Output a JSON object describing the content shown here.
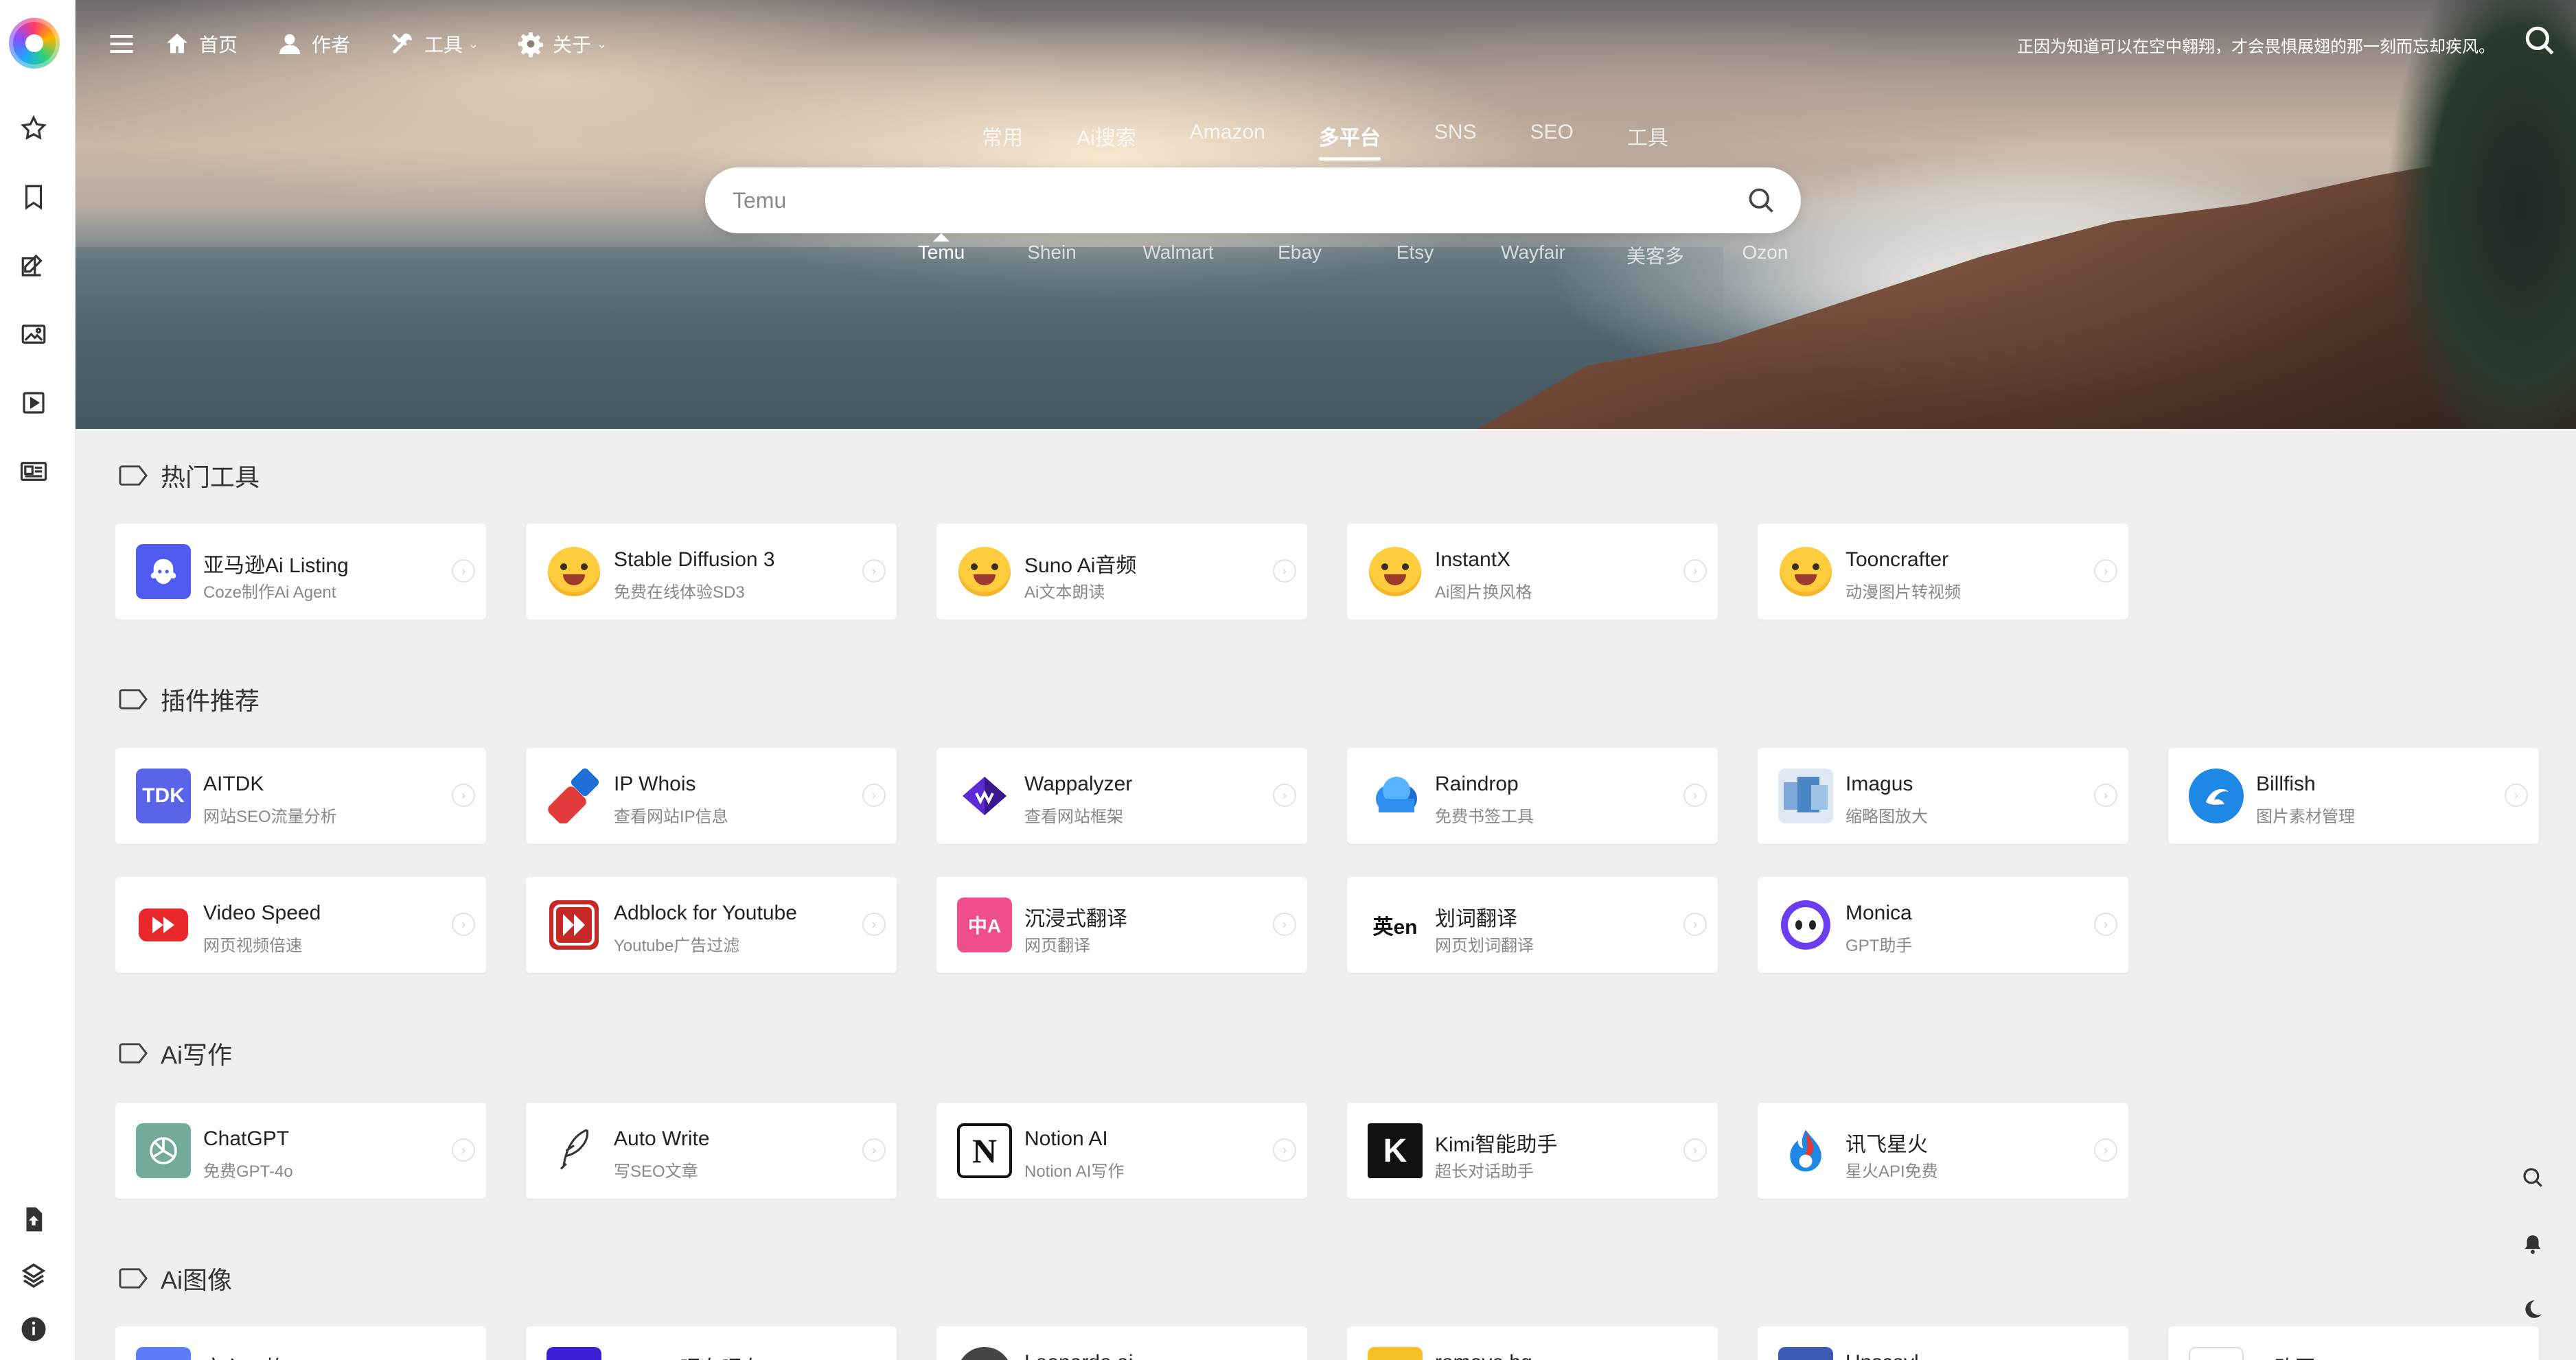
{
  "nav": {
    "items": [
      {
        "label": "首页",
        "icon": "home-icon"
      },
      {
        "label": "作者",
        "icon": "user-icon"
      },
      {
        "label": "工具",
        "icon": "tools-icon",
        "has_caret": true
      },
      {
        "label": "关于",
        "icon": "gear-icon",
        "has_caret": true
      }
    ],
    "motto": "正因为知道可以在空中翱翔，才会畏惧展翅的那一刻而忘却疾风。"
  },
  "search": {
    "category_tabs": [
      "常用",
      "Ai搜索",
      "Amazon",
      "多平台",
      "SNS",
      "SEO",
      "工具"
    ],
    "active_category": "多平台",
    "placeholder": "Temu",
    "engines": [
      "Temu",
      "Shein",
      "Walmart",
      "Ebay",
      "Etsy",
      "Wayfair",
      "美客多",
      "Ozon"
    ],
    "active_engine": "Temu"
  },
  "sections": [
    {
      "title": "热门工具",
      "cards": [
        {
          "name": "亚马逊Ai Listing",
          "desc": "Coze制作Ai Agent",
          "icon": "coze-icon",
          "color": "#4f5bf0"
        },
        {
          "name": "Stable Diffusion 3",
          "desc": "免费在线体验SD3",
          "icon": "hugging-face-icon",
          "color": "#ffcc3d"
        },
        {
          "name": "Suno Ai音频",
          "desc": "Ai文本朗读",
          "icon": "hugging-face-icon",
          "color": "#ffcc3d"
        },
        {
          "name": "InstantX",
          "desc": "Ai图片换风格",
          "icon": "hugging-face-icon",
          "color": "#ffcc3d"
        },
        {
          "name": "Tooncrafter",
          "desc": "动漫图片转视频",
          "icon": "hugging-face-icon",
          "color": "#ffcc3d"
        }
      ]
    },
    {
      "title": "插件推荐",
      "cards": [
        {
          "name": "AITDK",
          "desc": "网站SEO流量分析",
          "icon": "tdk-icon",
          "color": "#5b63e8",
          "glyph": "TDK"
        },
        {
          "name": "IP Whois",
          "desc": "查看网站IP信息",
          "icon": "ip-whois-icon",
          "color": "#e23b3b"
        },
        {
          "name": "Wappalyzer",
          "desc": "查看网站框架",
          "icon": "wappalyzer-icon",
          "color": "#5b2bd6"
        },
        {
          "name": "Raindrop",
          "desc": "免费书签工具",
          "icon": "raindrop-icon",
          "color": "#2f8ff0"
        },
        {
          "name": "Imagus",
          "desc": "缩略图放大",
          "icon": "imagus-icon",
          "color": "#6aa0d8"
        },
        {
          "name": "Billfish",
          "desc": "图片素材管理",
          "icon": "billfish-icon",
          "color": "#1e88e5"
        },
        {
          "name": "Video Speed",
          "desc": "网页视频倍速",
          "icon": "video-speed-icon",
          "color": "#e8282b"
        },
        {
          "name": "Adblock for Youtube",
          "desc": "Youtube广告过滤",
          "icon": "adblock-icon",
          "color": "#c62828"
        },
        {
          "name": "沉浸式翻译",
          "desc": "网页翻译",
          "icon": "immersive-translate-icon",
          "color": "#ee4e8c",
          "glyph": "中A"
        },
        {
          "name": "划词翻译",
          "desc": "网页划词翻译",
          "icon": "word-translate-icon",
          "color": "#ffffff",
          "glyph": "英en"
        },
        {
          "name": "Monica",
          "desc": "GPT助手",
          "icon": "monica-icon",
          "color": "#6a3df0"
        }
      ]
    },
    {
      "title": "Ai写作",
      "cards": [
        {
          "name": "ChatGPT",
          "desc": "免费GPT-4o",
          "icon": "chatgpt-icon",
          "color": "#74aa9c"
        },
        {
          "name": "Auto Write",
          "desc": "写SEO文章",
          "icon": "quill-icon",
          "color": "#ffffff"
        },
        {
          "name": "Notion AI",
          "desc": "Notion AI写作",
          "icon": "notion-icon",
          "color": "#ffffff",
          "glyph": "N"
        },
        {
          "name": "Kimi智能助手",
          "desc": "超长对话助手",
          "icon": "kimi-icon",
          "color": "#111111",
          "glyph": "K"
        },
        {
          "name": "讯飞星火",
          "desc": "星火API免费",
          "icon": "xinghuo-icon",
          "color": "#1e88e5"
        }
      ]
    },
    {
      "title": "Ai图像",
      "cards": [
        {
          "name": "文心一格",
          "desc": "",
          "icon": "yige-icon",
          "color": "#5c7cfa"
        },
        {
          "name": "LiblibAi哩布哩布",
          "desc": "",
          "icon": "liblib-icon",
          "color": "#3b1fd6"
        },
        {
          "name": "Leonardo.ai",
          "desc": "",
          "icon": "leonardo-icon",
          "color": "#444444"
        },
        {
          "name": "remove.bg",
          "desc": "",
          "icon": "removebg-icon",
          "color": "#f7c02b"
        },
        {
          "name": "Upscayl",
          "desc": "",
          "icon": "upscayl-icon",
          "color": "#3b5bb5"
        },
        {
          "name": "Ai改图",
          "desc": "",
          "icon": "ai-edit-icon",
          "color": "#ffffff"
        }
      ]
    }
  ],
  "colors": {
    "accent": "#4f5bf0",
    "page_bg": "#f0eeee",
    "card_bg": "#ffffff"
  }
}
